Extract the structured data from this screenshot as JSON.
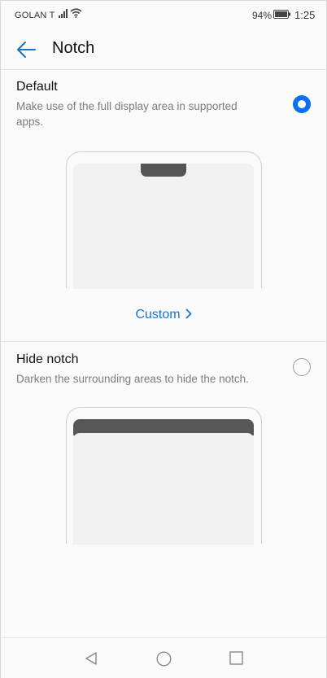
{
  "status_bar": {
    "carrier": "GOLAN T",
    "battery_percent": "94%",
    "time": "1:25",
    "icons": [
      "signal-icon",
      "wifi-icon",
      "battery-icon"
    ]
  },
  "header": {
    "title": "Notch",
    "back_icon": "arrow-left-icon"
  },
  "options": [
    {
      "title": "Default",
      "description_line1": "Make use of the full display area in supported",
      "description_line2": "apps.",
      "selected": true
    },
    {
      "title": "Hide notch",
      "description": "Darken the surrounding areas to hide the notch.",
      "selected": false
    }
  ],
  "custom_link": {
    "label": "Custom",
    "icon": "chevron-right-icon"
  },
  "nav_bar": {
    "icons": [
      "back-triangle-icon",
      "home-circle-icon",
      "recents-square-icon"
    ]
  },
  "colors": {
    "accent": "#0a6ff0",
    "link": "#1a74c9",
    "background": "#fafafa",
    "notch_dark": "#555555"
  }
}
